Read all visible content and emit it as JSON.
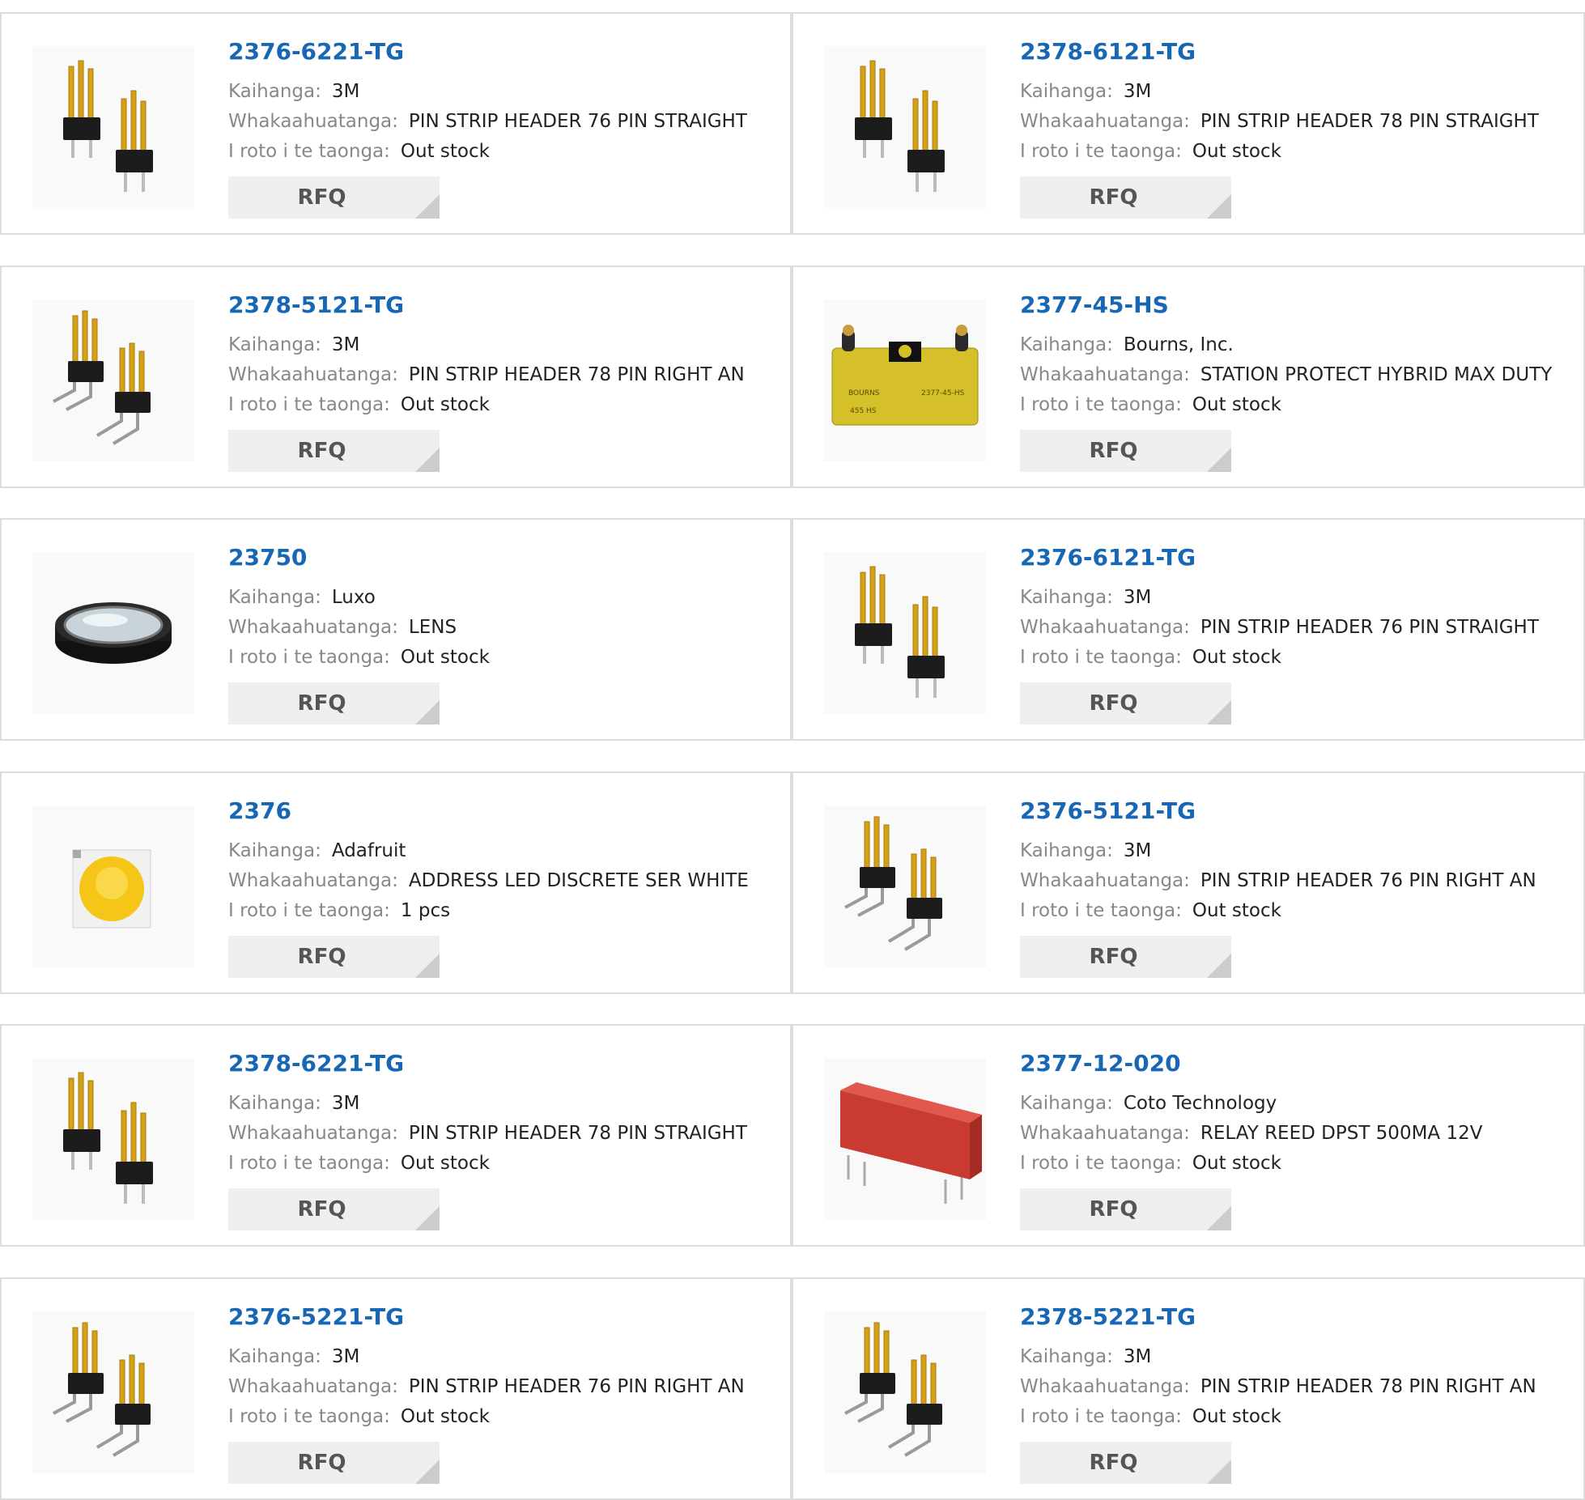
{
  "labels": {
    "manufacturer": "Kaihanga:",
    "description": "Whakaahuatanga:",
    "stock": "I roto i te taonga:",
    "rfq": "RFQ"
  },
  "products": [
    {
      "part": "2376-6221-TG",
      "manufacturer": "3M",
      "description": "PIN STRIP HEADER 76 PIN STRAIGHT",
      "stock": "Out stock",
      "image": "pin-header-straight"
    },
    {
      "part": "2378-6121-TG",
      "manufacturer": "3M",
      "description": "PIN STRIP HEADER 78 PIN STRAIGHT",
      "stock": "Out stock",
      "image": "pin-header-straight"
    },
    {
      "part": "2378-5121-TG",
      "manufacturer": "3M",
      "description": "PIN STRIP HEADER 78 PIN RIGHT AN",
      "stock": "Out stock",
      "image": "pin-header-right-angle"
    },
    {
      "part": "2377-45-HS",
      "manufacturer": "Bourns, Inc.",
      "description": "STATION PROTECT HYBRID MAX DUTY",
      "stock": "Out stock",
      "image": "station-protector"
    },
    {
      "part": "23750",
      "manufacturer": "Luxo",
      "description": "LENS",
      "stock": "Out stock",
      "image": "lens"
    },
    {
      "part": "2376-6121-TG",
      "manufacturer": "3M",
      "description": "PIN STRIP HEADER 76 PIN STRAIGHT",
      "stock": "Out stock",
      "image": "pin-header-straight"
    },
    {
      "part": "2376",
      "manufacturer": "Adafruit",
      "description": "ADDRESS LED DISCRETE SER WHITE",
      "stock": "1 pcs",
      "image": "led"
    },
    {
      "part": "2376-5121-TG",
      "manufacturer": "3M",
      "description": "PIN STRIP HEADER 76 PIN RIGHT AN",
      "stock": "Out stock",
      "image": "pin-header-right-angle"
    },
    {
      "part": "2378-6221-TG",
      "manufacturer": "3M",
      "description": "PIN STRIP HEADER 78 PIN STRAIGHT",
      "stock": "Out stock",
      "image": "pin-header-straight"
    },
    {
      "part": "2377-12-020",
      "manufacturer": "Coto Technology",
      "description": "RELAY REED DPST 500MA 12V",
      "stock": "Out stock",
      "image": "reed-relay"
    },
    {
      "part": "2376-5221-TG",
      "manufacturer": "3M",
      "description": "PIN STRIP HEADER 76 PIN RIGHT AN",
      "stock": "Out stock",
      "image": "pin-header-right-angle"
    },
    {
      "part": "2378-5221-TG",
      "manufacturer": "3M",
      "description": "PIN STRIP HEADER 78 PIN RIGHT AN",
      "stock": "Out stock",
      "image": "pin-header-right-angle"
    }
  ],
  "colors": {
    "part_link": "#1767b5",
    "label": "#888888",
    "value": "#222222",
    "card_border": "#dcdcdc",
    "button_bg": "#efefef",
    "button_text": "#555555"
  }
}
